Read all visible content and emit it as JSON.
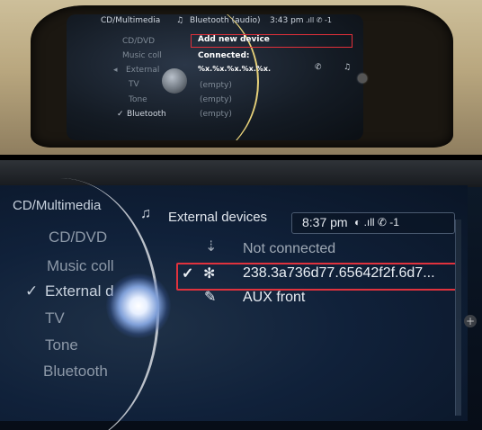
{
  "top": {
    "header": {
      "menu_title": "CD/Multimedia",
      "screen_title": "Bluetooth (audio)",
      "time": "3:43 pm",
      "status": ".ıll ✆ -1"
    },
    "menu": [
      "CD/DVD",
      "Music coll",
      "External",
      "TV",
      "Tone",
      "Bluetooth"
    ],
    "checked_item": "✓",
    "list": {
      "add_device": "Add new device",
      "connected_label": "Connected:",
      "connected_name": "%x.%x.%x.%x.%x.",
      "empty": [
        "(empty)",
        "(empty)",
        "(empty)"
      ]
    }
  },
  "bottom": {
    "menu_title": "CD/Multimedia",
    "screen_title": "External devices",
    "time": "8:37 pm",
    "status": "◐ .ıll ✆ -1",
    "menu": [
      "CD/DVD",
      "Music coll",
      "External d",
      "TV",
      "Tone",
      "Bluetooth"
    ],
    "checked_item": "✓",
    "devices": [
      {
        "label": "Not connected",
        "icon": "usb-icon"
      },
      {
        "label": "238.3a736d77.65642f2f.6d7...",
        "icon": "bluetooth-icon",
        "checked": "✓"
      },
      {
        "label": "AUX front",
        "icon": "aux-plug-icon"
      }
    ],
    "plus": "+"
  }
}
